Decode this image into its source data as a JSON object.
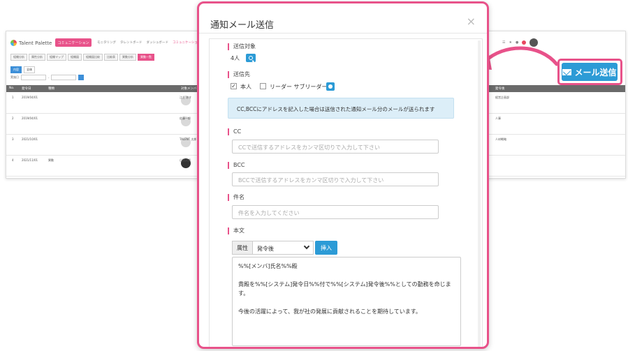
{
  "background_app": {
    "logo": "Talent Palette",
    "pink_button": "コミュニケーション",
    "nav": [
      "モニタリング",
      "タレントボード",
      "ダッシュボード",
      "コミュニケーション",
      "会議"
    ],
    "subtabs": [
      "組織分析",
      "属性分析",
      "組織マップ",
      "組織図",
      "組織図比較",
      "比較表",
      "異動分析",
      "異動一覧"
    ],
    "filter": [
      "内容",
      "全体"
    ],
    "search_label": "実施日",
    "table_headers": [
      "No.",
      "発令日",
      "種類",
      "対象メンバ",
      "発令後"
    ],
    "rows": [
      {
        "no": "1",
        "date": "2019/04/01",
        "type": "",
        "name": "江上 あす",
        "after": "経営企画部"
      },
      {
        "no": "2",
        "date": "2019/04/01",
        "type": "",
        "name": "佐藤一郎",
        "after": "人事"
      },
      {
        "no": "3",
        "date": "2021/10/01",
        "type": "",
        "name": "TALENT 太郎",
        "after": "人材戦略"
      },
      {
        "no": "4",
        "date": "2021/11/01",
        "type": "異動",
        "name": "山田太郎",
        "after": ""
      }
    ]
  },
  "mail_button": {
    "label": "メール送信"
  },
  "colors": {
    "accent": "#e8528a",
    "primary": "#2c9bd6",
    "info_bg": "#dceef8"
  },
  "modal": {
    "title": "通知メール送信",
    "close": "×",
    "recipients_label": "送信対象",
    "recipients_count": "4人",
    "destination_label": "送信先",
    "self_label": "本人",
    "leader_label": "リーダー サブリーダー",
    "info_text": "CC,BCCにアドレスを記入した場合は送信された通知メール分のメールが送られます",
    "cc_label": "CC",
    "cc_placeholder": "CCで送信するアドレスをカンマ区切りで入力して下さい",
    "bcc_label": "BCC",
    "bcc_placeholder": "BCCで送信するアドレスをカンマ区切りで入力して下さい",
    "subject_label": "件名",
    "subject_placeholder": "件名を入力してください",
    "body_label": "本文",
    "attr_label": "属性",
    "attr_value": "発令後",
    "insert_label": "挿入",
    "body_lines": [
      "%%[メンバ]氏名%%殿",
      "貴殿を%%[システム]発令日%%付で%%[システム]発令後%%としての勤務を命じます。",
      "今後の活躍によって、我が社の発展に貢献されることを期待しています。"
    ]
  }
}
